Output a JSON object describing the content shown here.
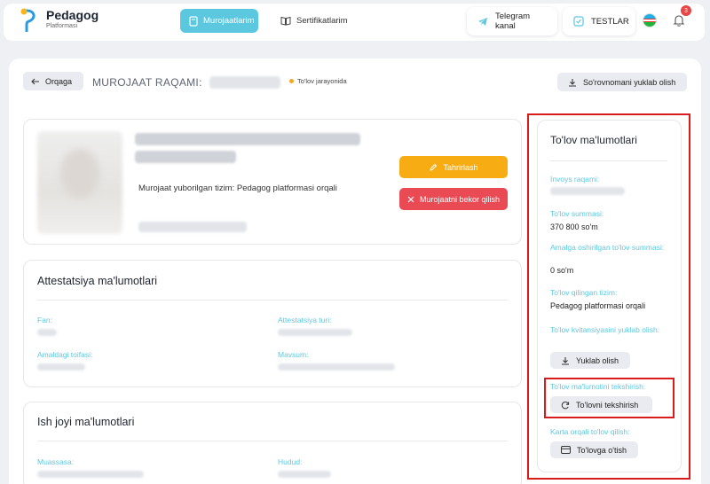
{
  "header": {
    "brand_name": "Pedagog",
    "brand_sub": "Platformasi",
    "nav_active": "Murojaatlarim",
    "nav_cert": "Sertifikatlarim",
    "telegram": "Telegram kanal",
    "tests": "TESTLAR",
    "notif_count": "3"
  },
  "toolbar": {
    "back": "Orqaga",
    "request_label": "MUROJAAT RAQAMI:",
    "status": "To'lov jarayonida",
    "download_survey": "So'rovnomani yuklab olish"
  },
  "profile": {
    "platform_text": "Murojaat yuborilgan tizim: Pedagog platformasi orqali",
    "edit": "Tahrirlash",
    "cancel": "Murojaatni bekor qilish"
  },
  "attestation": {
    "title": "Attestatsiya ma'lumotlari",
    "fan": "Fan:",
    "type": "Attestatsiya turi:",
    "category": "Amaldagi toifasi:",
    "season": "Mavsum:"
  },
  "work": {
    "title": "Ish joyi ma'lumotlari",
    "institution": "Muassasa:",
    "region": "Hudud:"
  },
  "payment": {
    "title": "To'lov ma'lumotlari",
    "invoice_label": "Invoys raqami:",
    "amount_label": "To'lov summasi:",
    "amount_value": "370 800 so'm",
    "paid_label": "Amalga oshirilgan to'lov summasi:",
    "paid_value": "0 so'm",
    "system_label": "To'lov qilingan tizim:",
    "system_value": "Pedagog platformasi orqali",
    "receipt_label": "To'lov kvitansiyasini yuklab olish:",
    "download": "Yuklab olish",
    "check_label": "To'lov ma'lumotini tekshirish:",
    "check_btn": "To'lovni tekshirish",
    "card_label": "Karta orqali to'lov qilish:",
    "card_btn": "To'lovga o'tish"
  },
  "colors": {
    "accent": "#5cc8e0",
    "edit": "#f8ac14",
    "cancel": "#ea4a54",
    "highlight": "#d81b1b"
  }
}
